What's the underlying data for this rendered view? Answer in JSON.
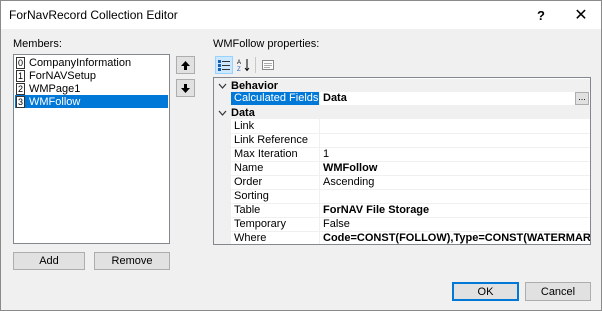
{
  "window": {
    "title": "ForNavRecord Collection Editor",
    "help_glyph": "?",
    "close_glyph": "✕"
  },
  "members": {
    "label": "Members:",
    "items": [
      {
        "index": "0",
        "name": "CompanyInformation"
      },
      {
        "index": "1",
        "name": "ForNAVSetup"
      },
      {
        "index": "2",
        "name": "WMPage1"
      },
      {
        "index": "3",
        "name": "WMFollow",
        "selected": true
      }
    ],
    "add_label": "Add",
    "remove_label": "Remove"
  },
  "properties": {
    "label": "WMFollow properties:",
    "categories": [
      {
        "name": "Behavior",
        "rows": [
          {
            "name": "Calculated Fields",
            "value": "Data",
            "bold": true,
            "selected": true,
            "has_ellipsis": true
          }
        ]
      },
      {
        "name": "Data",
        "rows": [
          {
            "name": "Link",
            "value": ""
          },
          {
            "name": "Link Reference",
            "value": ""
          },
          {
            "name": "Max Iteration",
            "value": "1"
          },
          {
            "name": "Name",
            "value": "WMFollow",
            "bold": true
          },
          {
            "name": "Order",
            "value": "Ascending"
          },
          {
            "name": "Sorting",
            "value": ""
          },
          {
            "name": "Table",
            "value": "ForNAV File Storage",
            "bold": true
          },
          {
            "name": "Temporary",
            "value": "False"
          },
          {
            "name": "Where",
            "value": "Code=CONST(FOLLOW),Type=CONST(WATERMARK)",
            "bold": true
          }
        ]
      }
    ],
    "ellipsis_label": "..."
  },
  "footer": {
    "ok_label": "OK",
    "cancel_label": "Cancel"
  },
  "colors": {
    "selection": "#0078d7",
    "dialog_bg": "#f0f0f0"
  }
}
